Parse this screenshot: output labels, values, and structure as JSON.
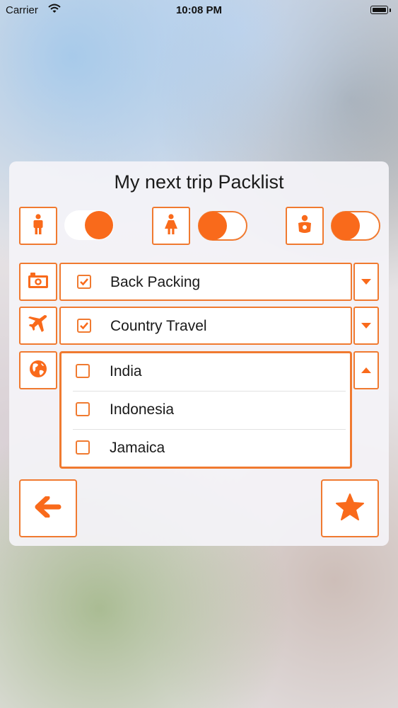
{
  "status_bar": {
    "carrier": "Carrier",
    "time": "10:08 PM"
  },
  "title": "My next trip Packlist",
  "accent_color": "#f96a1b",
  "travelers": [
    {
      "icon": "man-icon",
      "toggle_on": true
    },
    {
      "icon": "woman-icon",
      "toggle_on": false
    },
    {
      "icon": "baby-icon",
      "toggle_on": false
    }
  ],
  "categories": [
    {
      "icon": "camera-icon",
      "label": "Back Packing",
      "checked": true,
      "expanded": false
    },
    {
      "icon": "airplane-icon",
      "label": "Country Travel",
      "checked": true,
      "expanded": false
    },
    {
      "icon": "globe-icon",
      "expanded": true,
      "options": [
        {
          "label": "India",
          "checked": false
        },
        {
          "label": "Indonesia",
          "checked": false
        },
        {
          "label": "Jamaica",
          "checked": false
        }
      ]
    }
  ],
  "footer": {
    "back_icon": "back-arrow-icon",
    "favorite_icon": "star-icon"
  }
}
